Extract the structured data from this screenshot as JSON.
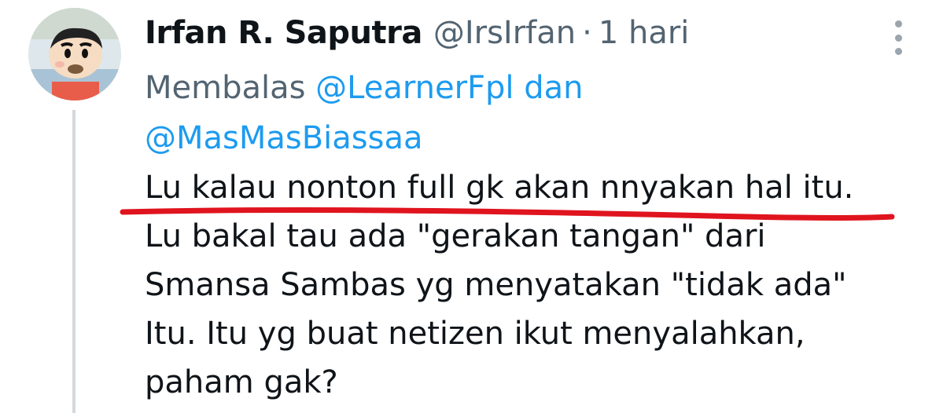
{
  "tweet": {
    "author_name": "Irfan R. Saputra",
    "handle": "@IrsIrfan",
    "separator": "·",
    "time": "1 hari",
    "reply_prefix": "Membalas",
    "reply_mention_1": "@LearnerFpl",
    "reply_joiner": "dan",
    "reply_mention_2": "@MasMasBiassaa",
    "body_lines": [
      "Lu kalau nonton full gk akan nnyakan hal itu.",
      "Lu bakal tau ada \"gerakan tangan\" dari",
      "Smansa Sambas yg menyatakan \"tidak ada\"",
      "Itu. Itu yg buat netizen ikut menyalahkan,",
      "paham gak?"
    ],
    "more_icon": "more-vertical-icon",
    "underline_color": "#e0141e"
  },
  "colors": {
    "text_primary": "#0f1419",
    "text_secondary": "#536471",
    "link": "#1d9bf0",
    "thread_line": "#d4d9de"
  }
}
